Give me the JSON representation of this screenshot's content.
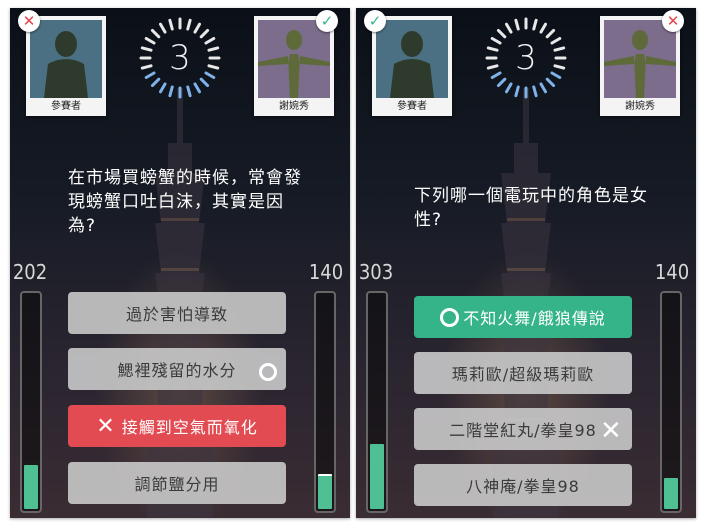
{
  "left_screen": {
    "player": {
      "name": "參賽者",
      "result": "wrong"
    },
    "opponent": {
      "name": "謝婉秀",
      "result": "right"
    },
    "timer": "3",
    "question": "在市場買螃蟹的時候，常會發現螃蟹口吐白沫，其實是因為?",
    "player_score": "202",
    "opponent_score": "140",
    "player_progress": 0.2,
    "opponent_progress": 0.15,
    "answers": [
      {
        "label": "過於害怕導致",
        "state": "normal"
      },
      {
        "label": "鰓裡殘留的水分",
        "state": "opponent-correct"
      },
      {
        "label": "接觸到空氣而氧化",
        "state": "player-wrong"
      },
      {
        "label": "調節鹽分用",
        "state": "normal"
      }
    ]
  },
  "right_screen": {
    "player": {
      "name": "參賽者",
      "result": "right"
    },
    "opponent": {
      "name": "謝婉秀",
      "result": "wrong"
    },
    "timer": "3",
    "question": "下列哪一個電玩中的角色是女性?",
    "player_score": "303",
    "opponent_score": "140",
    "player_progress": 0.3,
    "opponent_progress": 0.14,
    "answers": [
      {
        "label": "不知火舞/餓狼傳說",
        "state": "player-correct"
      },
      {
        "label": "瑪莉歐/超級瑪莉歐",
        "state": "normal"
      },
      {
        "label": "二階堂紅丸/拳皇98",
        "state": "opponent-wrong"
      },
      {
        "label": "八神庵/拳皇98",
        "state": "normal"
      }
    ]
  },
  "colors": {
    "correct": "#35b48a",
    "wrong": "#e24b52",
    "bar_fill": "#4fbf94"
  },
  "icons": {
    "wrong_badge": "x-icon",
    "right_badge": "check-icon",
    "correct_mark": "circle-icon",
    "wrong_mark": "cross-icon"
  }
}
